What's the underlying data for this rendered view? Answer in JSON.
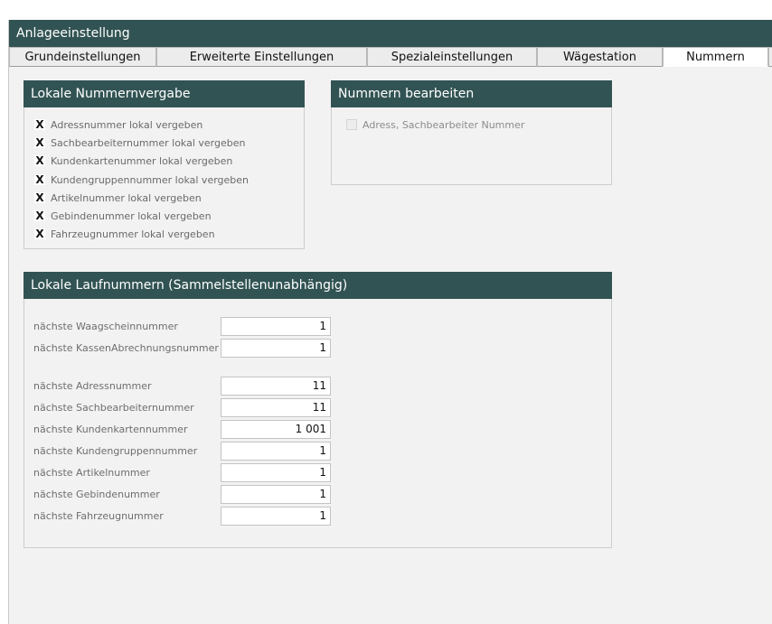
{
  "window": {
    "title": "Anlageeinstellung"
  },
  "tabs": [
    {
      "label": "Grundeinstellungen",
      "active": false
    },
    {
      "label": "Erweiterte Einstellungen",
      "active": false
    },
    {
      "label": "Spezialeinstellungen",
      "active": false
    },
    {
      "label": "Wägestation",
      "active": false
    },
    {
      "label": "Nummern",
      "active": true
    }
  ],
  "lokale_nummernvergabe": {
    "title": "Lokale Nummernvergabe",
    "items": [
      {
        "label": "Adressnummer lokal vergeben",
        "checked": true
      },
      {
        "label": "Sachbearbeiternummer lokal vergeben",
        "checked": true
      },
      {
        "label": "Kundenkartenummer lokal vergeben",
        "checked": true
      },
      {
        "label": "Kundengruppennummer lokal vergeben",
        "checked": true
      },
      {
        "label": "Artikelnummer lokal vergeben",
        "checked": true
      },
      {
        "label": "Gebindenummer lokal vergeben",
        "checked": true
      },
      {
        "label": "Fahrzeugnummer lokal vergeben",
        "checked": true
      }
    ],
    "check_mark": "X"
  },
  "nummern_bearbeiten": {
    "title": "Nummern bearbeiten",
    "items": [
      {
        "label": "Adress, Sachbearbeiter Nummer",
        "checked": false,
        "disabled": true
      }
    ]
  },
  "lokale_laufnummern": {
    "title": "Lokale Laufnummern (Sammelstellenunabhängig)",
    "group1": [
      {
        "label": "nächste Waagscheinnummer",
        "value": "1"
      },
      {
        "label": "nächste KassenAbrechnungsnummer",
        "value": "1"
      }
    ],
    "group2": [
      {
        "label": "nächste Adressnummer",
        "value": "11"
      },
      {
        "label": "nächste Sachbearbeiternummer",
        "value": "11"
      },
      {
        "label": "nächste Kundenkartennummer",
        "value": "1 001"
      },
      {
        "label": "nächste Kundengruppennummer",
        "value": "1"
      },
      {
        "label": "nächste Artikelnummer",
        "value": "1"
      },
      {
        "label": "nächste Gebindenummer",
        "value": "1"
      },
      {
        "label": "nächste Fahrzeugnummer",
        "value": "1"
      }
    ]
  },
  "colors": {
    "header": "#325353",
    "background": "#f2f2f2"
  }
}
